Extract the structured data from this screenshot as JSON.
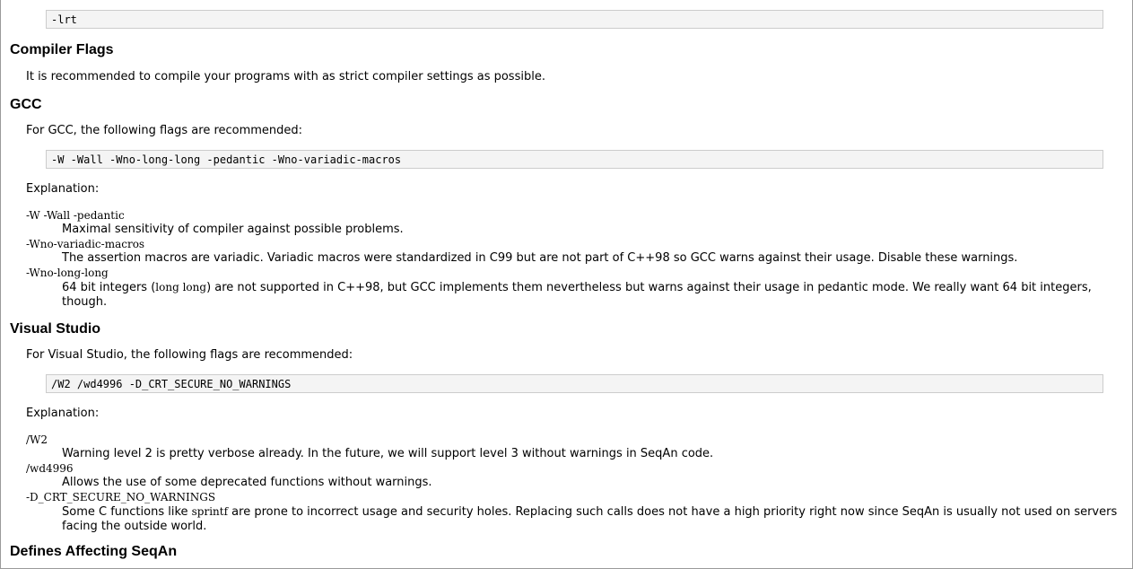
{
  "top_code": "-lrt",
  "compiler_flags": {
    "heading": "Compiler Flags",
    "intro": "It is recommended to compile your programs with as strict compiler settings as possible."
  },
  "gcc": {
    "heading": "GCC",
    "intro": "For GCC, the following flags are recommended:",
    "code": "-W -Wall -Wno-long-long -pedantic -Wno-variadic-macros",
    "explanation_label": "Explanation:",
    "items": [
      {
        "term": "-W -Wall -pedantic",
        "desc": "Maximal sensitivity of compiler against possible problems."
      },
      {
        "term": "-Wno-variadic-macros",
        "desc": "The assertion macros are variadic. Variadic macros were standardized in C99 but are not part of C++98 so GCC warns against their usage. Disable these warnings."
      },
      {
        "term": "-Wno-long-long",
        "desc_before": "64 bit integers (",
        "desc_code": "long long",
        "desc_after": ") are not supported in C++98, but GCC implements them nevertheless but warns against their usage in pedantic mode. We really want 64 bit integers, though."
      }
    ]
  },
  "visual_studio": {
    "heading": "Visual Studio",
    "intro": "For Visual Studio, the following flags are recommended:",
    "code": "/W2 /wd4996 -D_CRT_SECURE_NO_WARNINGS",
    "explanation_label": "Explanation:",
    "items": [
      {
        "term": "/W2",
        "desc": "Warning level 2 is pretty verbose already. In the future, we will support level 3 without warnings in SeqAn code."
      },
      {
        "term": "/wd4996",
        "desc": "Allows the use of some deprecated functions without warnings."
      },
      {
        "term": "-D_CRT_SECURE_NO_WARNINGS",
        "desc_before": "Some C functions like ",
        "desc_code": "sprintf",
        "desc_after": " are prone to incorrect usage and security holes. Replacing such calls does not have a high priority right now since SeqAn is usually not used on servers facing the outside world."
      }
    ]
  },
  "defines": {
    "heading": "Defines Affecting SeqAn"
  }
}
